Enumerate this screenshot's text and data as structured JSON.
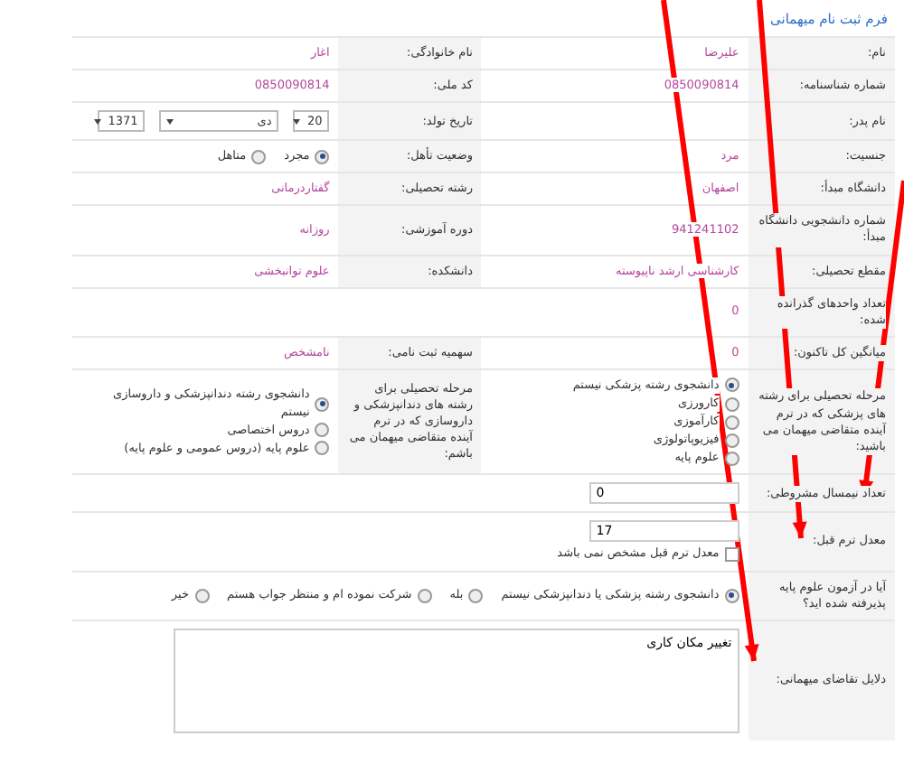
{
  "form_title": "فرم ثبت نام میهمانی",
  "rows": [
    {
      "cells": [
        {
          "label": "نام:",
          "value": {
            "kind": "text",
            "text": "علیرضا"
          }
        },
        {
          "label": "نام خانوادگی:",
          "value": {
            "kind": "text",
            "text": "اغار"
          }
        }
      ]
    },
    {
      "cells": [
        {
          "label": "شماره شناسنامه:",
          "value": {
            "kind": "text",
            "text": "0850090814"
          }
        },
        {
          "label": "کد ملی:",
          "value": {
            "kind": "text",
            "text": "0850090814"
          }
        }
      ]
    },
    {
      "cells": [
        {
          "label": "نام پدر:"
        },
        {
          "label": "تاریخ تولد:",
          "value": {
            "kind": "date",
            "day": "20",
            "month": "دی",
            "year": "1371"
          }
        }
      ]
    },
    {
      "cells": [
        {
          "label": "جنسیت:",
          "value": {
            "kind": "text",
            "text": "مرد"
          }
        },
        {
          "label": "وضعیت تأهل:",
          "value": {
            "kind": "radio_row",
            "options": [
              {
                "label": "مجرد",
                "selected": true
              },
              {
                "label": "متاهل",
                "selected": false
              }
            ]
          }
        }
      ]
    },
    {
      "cells": [
        {
          "label": "دانشگاه مبدأ:",
          "value": {
            "kind": "text",
            "text": "اصفهان"
          }
        },
        {
          "label": "رشته تحصیلی:",
          "value": {
            "kind": "text",
            "text": "گفتاردرمانی"
          }
        }
      ]
    },
    {
      "cells": [
        {
          "label": "شماره دانشجویی دانشگاه مبدأ:",
          "value": {
            "kind": "text",
            "text": "941241102"
          }
        },
        {
          "label": "دوره آموزشی:",
          "value": {
            "kind": "text",
            "text": "روزانه"
          }
        }
      ]
    },
    {
      "cells": [
        {
          "label": "مقطع تحصیلی:",
          "value": {
            "kind": "text",
            "text": "کارشناسی ارشد ناپیوسته"
          }
        },
        {
          "label": "دانشکده:",
          "value": {
            "kind": "text",
            "text": "علوم توانبخشی"
          }
        }
      ]
    },
    {
      "cells": [
        {
          "label": "تعداد واحدهای گذرانده شده:",
          "value": {
            "kind": "text",
            "text": "0"
          }
        }
      ]
    },
    {
      "cells": [
        {
          "label": "میانگین کل تاکنون:",
          "value": {
            "kind": "text",
            "text": "0"
          }
        },
        {
          "label": "سهمیه ثبت نامی:",
          "value": {
            "kind": "text",
            "text": "نامشخص"
          }
        }
      ]
    },
    {
      "cells": [
        {
          "label": "مرحله تحصیلی برای رشته های پزشکی که در ترم آینده متقاضی میهمان می باشید:",
          "value": {
            "kind": "radio_list",
            "options": [
              {
                "label": "دانشجوی رشته پزشکی نیستم",
                "selected": true
              },
              {
                "label": "کارورزی",
                "selected": false
              },
              {
                "label": "کارآموزی",
                "selected": false
              },
              {
                "label": "فیزیوپاتولوژی",
                "selected": false
              },
              {
                "label": "علوم پایه",
                "selected": false
              }
            ]
          }
        },
        {
          "label": "مرحله تحصیلی برای رشته های دندانپزشکی و داروسازی که در ترم آینده متقاضی میهمان می باشم:",
          "value": {
            "kind": "radio_list",
            "options": [
              {
                "label": "دانشجوی رشته دندانپزشکی و داروسازی نیستم",
                "selected": true
              },
              {
                "label": "دروس اختصاصی",
                "selected": false
              },
              {
                "label": "علوم پایه (دروس عمومی و علوم پایه)",
                "selected": false
              }
            ]
          }
        }
      ]
    },
    {
      "cells": [
        {
          "label": "تعداد نیمسال مشروطی:",
          "value": {
            "kind": "input",
            "value": "0"
          }
        }
      ]
    },
    {
      "cells": [
        {
          "label": "معدل ترم قبل:",
          "value": {
            "kind": "input",
            "value": "17",
            "checkbox": {
              "label": "معدل ترم قبل مشخص نمی باشد",
              "checked": false
            }
          }
        }
      ]
    },
    {
      "cells": [
        {
          "label": "آیا در آزمون علوم پایه پذیرفته شده اید؟",
          "value": {
            "kind": "radio_row",
            "options": [
              {
                "label": "دانشجوی رشته پزشکی یا دندانپزشکی نیستم",
                "selected": true
              },
              {
                "label": "بله",
                "selected": false
              },
              {
                "label": "شرکت نموده ام و منتظر جواب هستم",
                "selected": false
              },
              {
                "label": "خیر",
                "selected": false
              }
            ]
          }
        }
      ]
    },
    {
      "cells": [
        {
          "label": "دلایل تقاضای میهمانی:",
          "value": {
            "kind": "textarea",
            "value": "تغییر مکان کاری"
          }
        }
      ]
    }
  ]
}
